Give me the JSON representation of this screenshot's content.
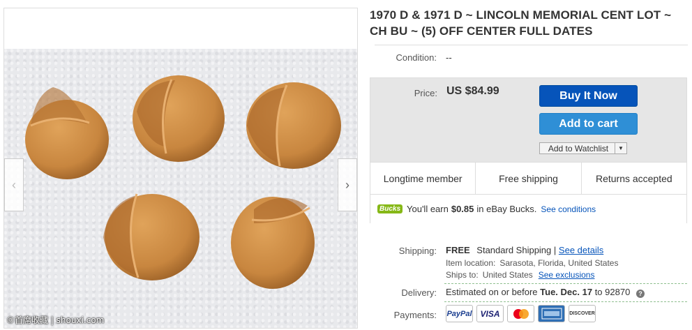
{
  "listing": {
    "title": "1970 D & 1971 D ~ LINCOLN MEMORIAL CENT LOT ~ CH BU ~ (5) OFF CENTER FULL DATES"
  },
  "gallery": {
    "prev_icon": "chevron-left-icon",
    "next_icon": "chevron-right-icon",
    "prev_glyph": "‹",
    "next_glyph": "›",
    "watermark": "©首席收藏 | shouxi.com",
    "coin_color": "#c8863f"
  },
  "condition": {
    "label": "Condition:",
    "value": "--"
  },
  "buybox": {
    "price_label": "Price:",
    "price_value": "US $84.99",
    "buy_now": "Buy It Now",
    "add_to_cart": "Add to cart",
    "add_to_watchlist": "Add to Watchlist",
    "watchlist_dropdown": "▼",
    "badges": [
      "Longtime member",
      "Free shipping",
      "Returns accepted"
    ],
    "bucks": {
      "logo": "Bucks",
      "text_before": "You'll earn",
      "amount": "$0.85",
      "text_after": "in eBay Bucks.",
      "link": "See conditions"
    }
  },
  "shipping": {
    "label": "Shipping:",
    "free": "FREE",
    "method": "Standard Shipping",
    "separator": "|",
    "details_link": "See details",
    "location_label": "Item location:",
    "location_value": "Sarasota, Florida, United States",
    "ships_to_label": "Ships to:",
    "ships_to_value": "United States",
    "exclusions_link": "See exclusions"
  },
  "delivery": {
    "label": "Delivery:",
    "text_before": "Estimated on or before",
    "date": "Tue. Dec. 17",
    "text_mid": "to",
    "zip": "92870",
    "help_glyph": "?"
  },
  "payments": {
    "label": "Payments:",
    "methods": [
      "PayPal",
      "VISA",
      "MasterCard",
      "AMEX",
      "DISCOVER"
    ]
  },
  "colors": {
    "buy_now_bg": "#0654ba",
    "add_to_cart_bg": "#2f8fd6",
    "link": "#0654ba",
    "bucks_green": "#86b817"
  }
}
